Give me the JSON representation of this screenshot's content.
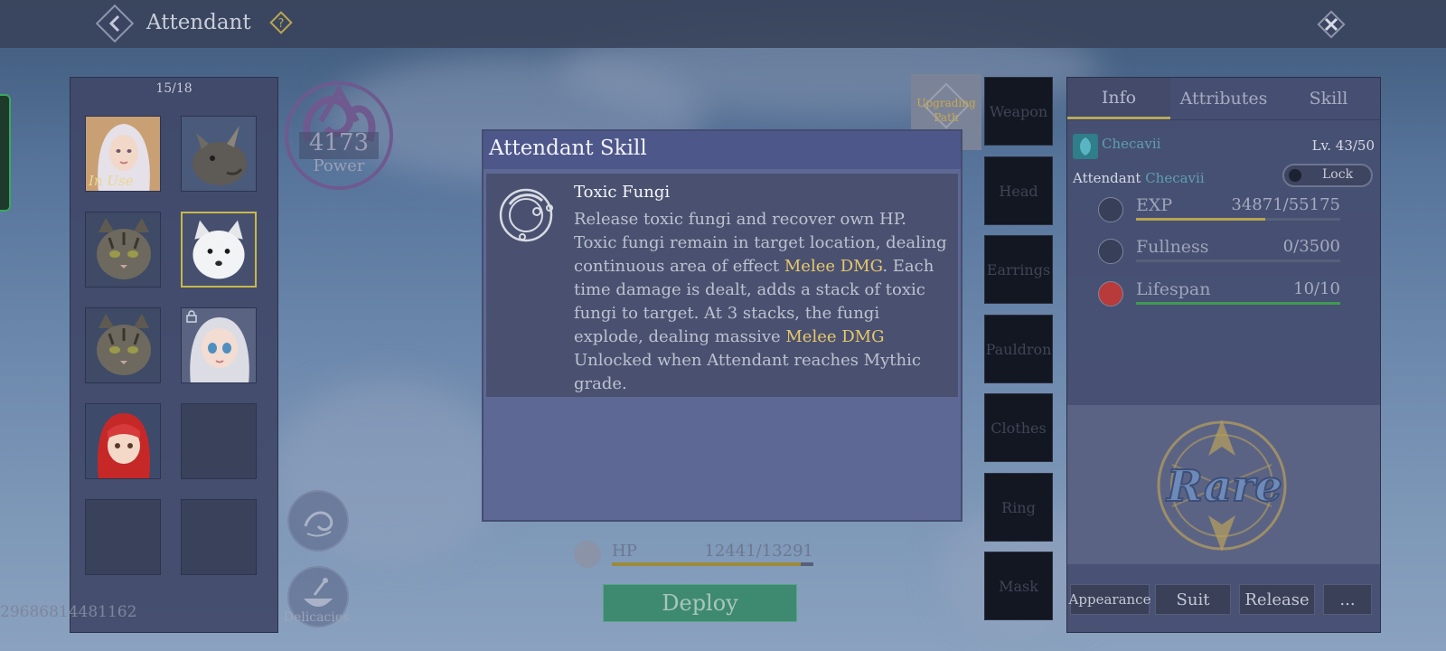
{
  "header": {
    "title": "Attendant"
  },
  "attendant_list": {
    "count": "15/18",
    "in_use_label": "In Use",
    "slots": [
      {
        "portrait": "white-haired-woman",
        "in_use": true
      },
      {
        "portrait": "rhino"
      },
      {
        "portrait": "tabby-cat"
      },
      {
        "portrait": "white-fox",
        "selected": true
      },
      {
        "portrait": "tabby-cat"
      },
      {
        "portrait": "doll-girl",
        "locked": true
      },
      {
        "portrait": "red-haired-doll"
      },
      {
        "portrait": "empty"
      },
      {
        "portrait": "empty"
      },
      {
        "portrait": "empty"
      }
    ]
  },
  "power": {
    "value": "4173",
    "label": "Power"
  },
  "delicacies": {
    "label": "Delicacies"
  },
  "user_id": "29686814481162",
  "upgrade_path": {
    "label": "Upgrading Path"
  },
  "equipment_slots": [
    "Weapon",
    "Head",
    "Earrings",
    "Pauldron",
    "Clothes",
    "Ring",
    "Mask"
  ],
  "skill_dialog": {
    "title": "Attendant Skill",
    "skill_name": "Toxic Fungi",
    "desc_part1": "Release toxic fungi and recover own HP.  Toxic fungi remain in target location, dealing continuous area of effect ",
    "desc_hl1": "Melee DMG",
    "desc_part2": ". Each time damage is dealt, adds a stack of toxic fungi to target. At 3 stacks, the fungi explode, dealing massive ",
    "desc_hl2": "Melee DMG",
    "unlock_text": "Unlocked when Attendant reaches Mythic grade."
  },
  "hp": {
    "label": "HP",
    "value": "12441/13291",
    "fraction": 0.936
  },
  "deploy": {
    "label": "Deploy"
  },
  "info_panel": {
    "tabs": [
      "Info",
      "Attributes",
      "Skill"
    ],
    "active_tab": "Info",
    "name": "Checavii",
    "level": "Lv. 43/50",
    "attendant_prefix": "Attendant",
    "attendant_name": "Checavii",
    "lock_label": "Lock",
    "stats": [
      {
        "label": "EXP",
        "value": "34871/55175",
        "fraction": 0.632,
        "color": "#b9a451"
      },
      {
        "label": "Fullness",
        "value": "0/3500",
        "fraction": 0.0,
        "color": "#b9a451"
      },
      {
        "label": "Lifespan",
        "value": "10/10",
        "fraction": 1.0,
        "color": "#3f9a52"
      }
    ],
    "rarity": "Rare",
    "buttons": [
      "Appearance",
      "Suit",
      "Release",
      "..."
    ]
  }
}
